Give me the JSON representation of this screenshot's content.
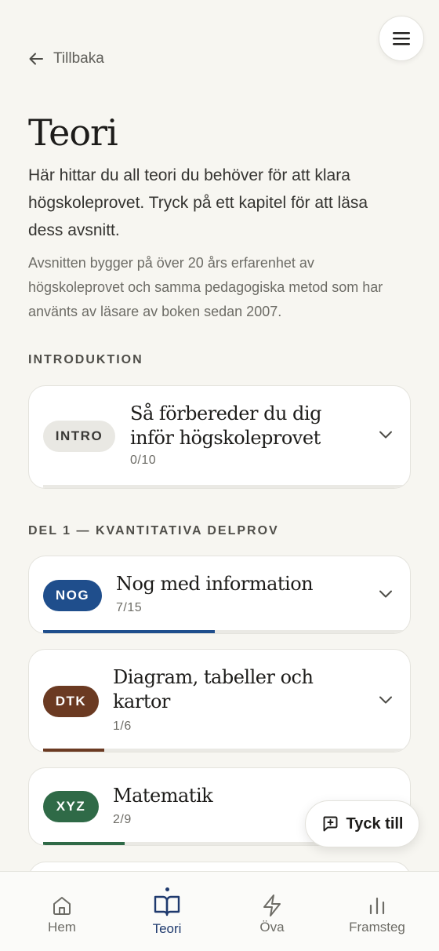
{
  "header": {
    "back_label": "Tillbaka",
    "title": "Teori",
    "intro": "Här hittar du all teori du behöver för att klara högskoleprovet. Tryck på ett kapitel för att läsa dess avsnitt.",
    "subtext": "Avsnitten bygger på över 20 års erfarenhet av högskoleprovet och samma pedagogiska metod som har använts av läsare av boken sedan 2007."
  },
  "sections": [
    {
      "label": "INTRODUKTION",
      "chapters": [
        {
          "badge": "INTRO",
          "title": "Så förbereder du dig inför högskoleprovet",
          "progress_text": "0/10",
          "progress": 0.0,
          "badge_bg": "#e9e8e3",
          "badge_fg": "#3a3936",
          "bar_color": "#8a8984"
        }
      ]
    },
    {
      "label": "DEL 1 — KVANTITATIVA DELPROV",
      "chapters": [
        {
          "badge": "NOG",
          "title": "Nog med information",
          "progress_text": "7/15",
          "progress": 0.467,
          "badge_bg": "#1f4e8c",
          "badge_fg": "#ffffff",
          "bar_color": "#1f4e8c"
        },
        {
          "badge": "DTK",
          "title": "Diagram, tabeller och kartor",
          "progress_text": "1/6",
          "progress": 0.167,
          "badge_bg": "#6b3a22",
          "badge_fg": "#ffffff",
          "bar_color": "#6b3a22"
        },
        {
          "badge": "XYZ",
          "title": "Matematik",
          "progress_text": "2/9",
          "progress": 0.222,
          "badge_bg": "#2f6a47",
          "badge_fg": "#ffffff",
          "bar_color": "#2f6a47"
        }
      ]
    }
  ],
  "feedback_label": "Tyck till",
  "nav": {
    "items": [
      {
        "label": "Hem",
        "icon": "home-icon"
      },
      {
        "label": "Teori",
        "icon": "book-icon",
        "active": true
      },
      {
        "label": "Öva",
        "icon": "lightning-icon"
      },
      {
        "label": "Framsteg",
        "icon": "bar-chart-icon"
      }
    ]
  },
  "colors": {
    "background": "#f7f6f1",
    "accent": "#1f3a6e"
  }
}
